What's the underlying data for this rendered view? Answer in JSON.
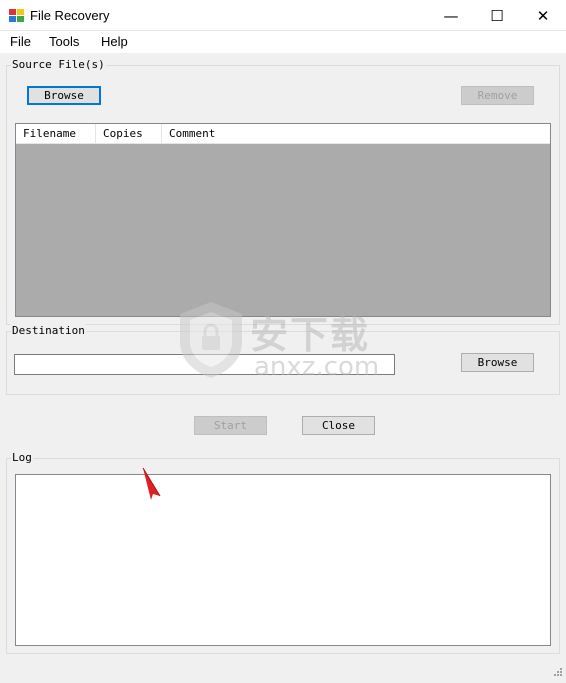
{
  "window": {
    "title": "File Recovery",
    "minimize_glyph": "—",
    "maximize_glyph": "☐",
    "close_glyph": "✕",
    "icon": "app-icon"
  },
  "menu": [
    {
      "label": "File"
    },
    {
      "label": "Tools"
    },
    {
      "label": "Help"
    }
  ],
  "source": {
    "legend": "Source File(s)",
    "browse_label": "Browse",
    "remove_label": "Remove",
    "columns": [
      "Filename",
      "Copies",
      "Comment"
    ]
  },
  "destination": {
    "legend": "Destination",
    "path_value": "",
    "browse_label": "Browse"
  },
  "actions": {
    "start_label": "Start",
    "close_label": "Close"
  },
  "log": {
    "legend": "Log",
    "content": ""
  },
  "watermark": {
    "cn_text": "安下载",
    "en_text": "anxz.com"
  },
  "colors": {
    "focus_blue": "#0078d7",
    "list_empty_bg": "#ababab",
    "annotation_arrow": "#e02020"
  }
}
